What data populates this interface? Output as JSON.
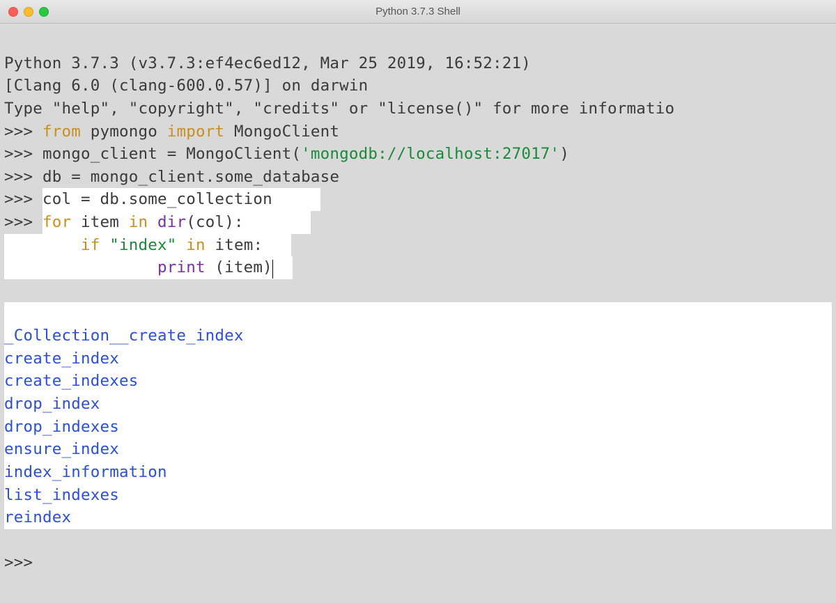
{
  "window": {
    "title": "Python 3.7.3 Shell"
  },
  "banner": {
    "line1": "Python 3.7.3 (v3.7.3:ef4ec6ed12, Mar 25 2019, 16:52:21) ",
    "line2": "[Clang 6.0 (clang-600.0.57)] on darwin",
    "line3": "Type \"help\", \"copyright\", \"credits\" or \"license()\" for more informatio"
  },
  "prompt": ">>> ",
  "code": {
    "l1_from": "from",
    "l1_mid": " pymongo ",
    "l1_import": "import",
    "l1_end": " MongoClient",
    "l2_pre": "mongo_client = MongoClient(",
    "l2_str": "'mongodb://localhost:27017'",
    "l2_post": ")",
    "l3": "db = mongo_client.some_database",
    "l4": "col = db.some_collection",
    "l5_for": "for",
    "l5_mid1": " item ",
    "l5_in": "in",
    "l5_dir": " dir",
    "l5_tail": "(col):",
    "l6_indent": "        ",
    "l6_if": "if",
    "l6_mid": " ",
    "l6_str": "\"index\"",
    "l6_in_sp": " ",
    "l6_in": "in",
    "l6_tail": " item:",
    "l7_indent": "                ",
    "l7_print": "print",
    "l7_tail": " (item)"
  },
  "output": [
    "_Collection__create_index",
    "create_index",
    "create_indexes",
    "drop_index",
    "drop_indexes",
    "ensure_index",
    "index_information",
    "list_indexes",
    "reindex"
  ]
}
